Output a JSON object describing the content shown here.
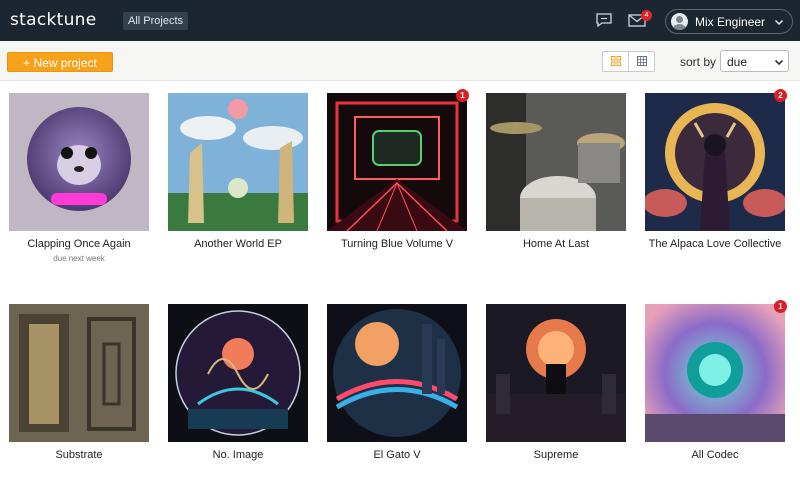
{
  "nav": {
    "logo": "stacktune",
    "all_projects": "All Projects",
    "mail_count": "4",
    "user_name": "Mix Engineer"
  },
  "toolbar": {
    "new_project": "+ New project",
    "sort_label": "sort by",
    "sort_value": "due"
  },
  "icons": {
    "chat": "chat-bubble-icon",
    "mail": "envelope-icon",
    "avatar": "user-avatar-icon",
    "caret": "chevron-down-icon",
    "large_grid": "large-grid-icon",
    "small_grid": "small-grid-icon"
  },
  "colors": {
    "nav_bg": "#1c2630",
    "accent": "#f7a21b",
    "badge": "#d81f26"
  },
  "projects": [
    {
      "title": "Clapping Once Again",
      "subtitle": "due next week",
      "badge": ""
    },
    {
      "title": "Another World EP",
      "subtitle": "",
      "badge": ""
    },
    {
      "title": "Turning Blue Volume V",
      "subtitle": "",
      "badge": "1"
    },
    {
      "title": "Home At Last",
      "subtitle": "",
      "badge": ""
    },
    {
      "title": "The Alpaca Love Collective",
      "subtitle": "",
      "badge": "2"
    },
    {
      "title": "Substrate",
      "subtitle": "",
      "badge": ""
    },
    {
      "title": "No. Image",
      "subtitle": "",
      "badge": ""
    },
    {
      "title": "El Gato V",
      "subtitle": "",
      "badge": ""
    },
    {
      "title": "Supreme",
      "subtitle": "",
      "badge": ""
    },
    {
      "title": "All Codec",
      "subtitle": "",
      "badge": "1"
    }
  ]
}
